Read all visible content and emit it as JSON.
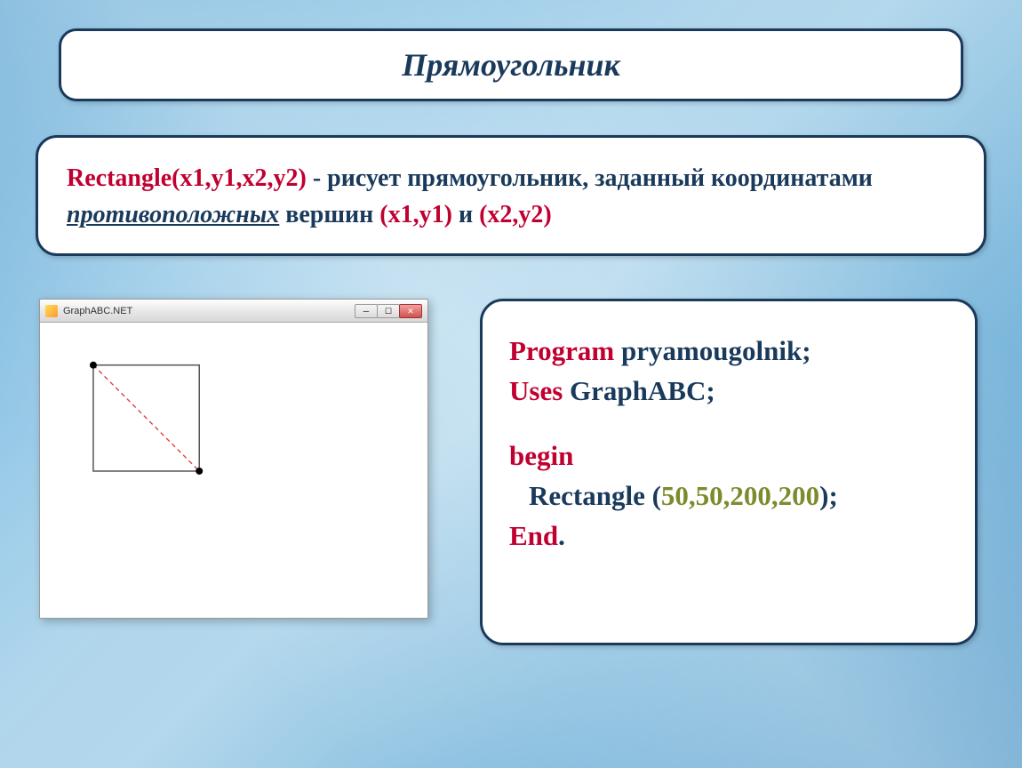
{
  "title": "Прямоугольник",
  "description": {
    "syntax": "Rectangle(х1,у1,х2,у2)",
    "dash": " - ",
    "part1": "рисует прямоугольник, заданный координатами ",
    "italic": "противоположных",
    "part2": " вершин ",
    "coord1": "(х1,у1)",
    "and": " и ",
    "coord2": "(х2,у2)"
  },
  "window": {
    "title": "GraphABC.NET",
    "buttons": {
      "min": "─",
      "max": "☐",
      "close": "✕"
    }
  },
  "code": {
    "line1_kw": "Program",
    "line1_id": " pryamougolnik;",
    "line2_kw": "Uses",
    "line2_id": " GraphABC;",
    "line3_kw": "begin",
    "line4_id": "Rectangle ",
    "line4_paren_open": "(",
    "line4_nums": "50,50,200,200",
    "line4_paren_close": ");",
    "line5_kw": "End",
    "line5_dot": "."
  }
}
